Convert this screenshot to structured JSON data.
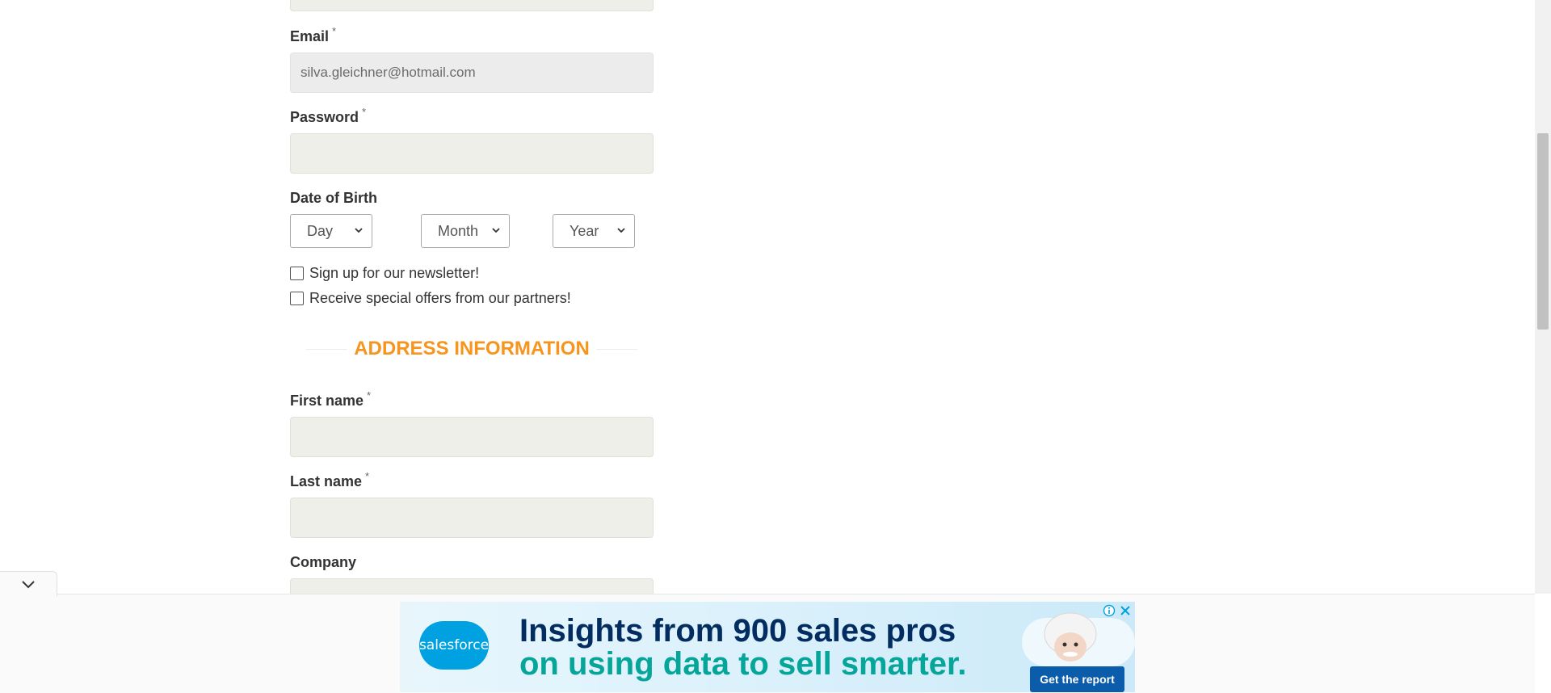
{
  "form": {
    "email": {
      "label": "Email",
      "required_mark": "*",
      "value": "silva.gleichner@hotmail.com"
    },
    "password": {
      "label": "Password",
      "required_mark": "*",
      "value": ""
    },
    "dob": {
      "label": "Date of Birth",
      "day": "Day",
      "month": "Month",
      "year": "Year"
    },
    "newsletter": {
      "label": "Sign up for our newsletter!",
      "checked": false
    },
    "offers": {
      "label": "Receive special offers from our partners!",
      "checked": false
    },
    "address_heading": "ADDRESS INFORMATION",
    "first_name": {
      "label": "First name",
      "required_mark": "*",
      "value": ""
    },
    "last_name": {
      "label": "Last name",
      "required_mark": "*",
      "value": ""
    },
    "company": {
      "label": "Company",
      "value": ""
    }
  },
  "ad": {
    "brand": "salesforce",
    "line1": "Insights from 900 sales pros",
    "line2": "on using data to sell smarter.",
    "cta": "Get the report",
    "colors": {
      "navy": "#032d60",
      "teal": "#06a59a",
      "brand_blue": "#00a1e0"
    }
  },
  "theme": {
    "accent": "#f7941d",
    "input_bg": "#efefe9"
  },
  "icons": {
    "collapse": "chevron-down-icon",
    "ad_info": "info-icon",
    "ad_close": "close-icon",
    "select_arrow": "chevron-down-icon"
  }
}
